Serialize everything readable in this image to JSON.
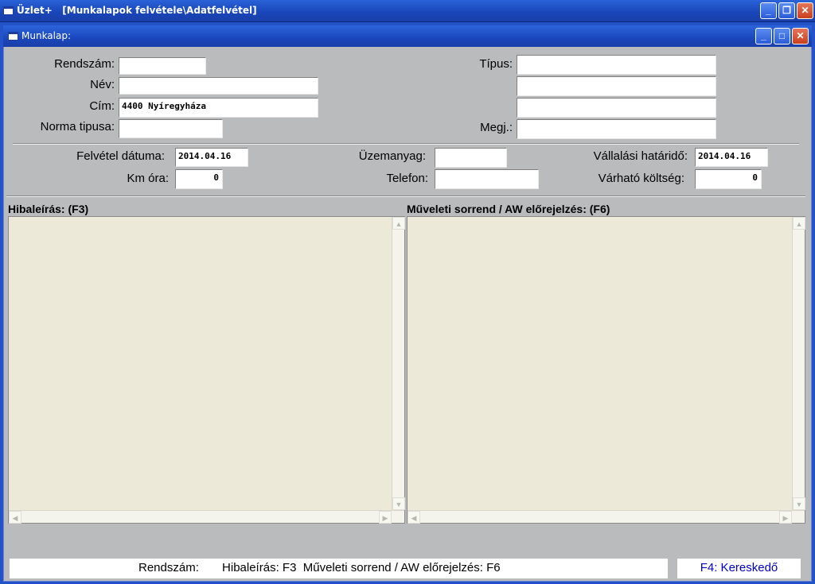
{
  "window": {
    "title": "Üzlet+   [Munkalapok felvétele\\Adatfelvétel]"
  },
  "child_window": {
    "title": "Munkalap:"
  },
  "title_buttons": {
    "minimize": "_",
    "restore": "❐",
    "maximize": "□",
    "close": "✕"
  },
  "form": {
    "rendszam": {
      "label": "Rendszám:",
      "value": ""
    },
    "nev": {
      "label": "Név:",
      "value": ""
    },
    "cim": {
      "label": "Cím:",
      "value": "4400 Nyíregyháza"
    },
    "norma": {
      "label": "Norma tipusa:",
      "value": ""
    },
    "tipus": {
      "label": "Típus:",
      "value": ""
    },
    "tipus2": {
      "value": ""
    },
    "tipus3": {
      "value": ""
    },
    "megj": {
      "label": "Megj.:",
      "value": ""
    },
    "felvetel": {
      "label": "Felvétel dátuma:",
      "value": "2014.04.16"
    },
    "km": {
      "label": "Km óra:",
      "value": "0"
    },
    "uzemanyag": {
      "label": "Üzemanyag:",
      "value": ""
    },
    "telefon": {
      "label": "Telefon:",
      "value": ""
    },
    "vallalasi": {
      "label": "Vállalási határidő:",
      "value": "2014.04.16"
    },
    "varhato": {
      "label": "Várható költség:",
      "value": "0"
    }
  },
  "sections": {
    "hibaleiras": "Hibaleírás:  (F3)",
    "muveleti": "Műveleti sorrend / AW előrejelzés:  (F6)"
  },
  "scroll": {
    "up": "▲",
    "down": "▼",
    "left": "◀",
    "right": "▶"
  },
  "status": {
    "text": "Rendszám:       Hibaleírás: F3  Műveleti sorrend / AW előrejelzés: F6",
    "dealer": "F4: Kereskedő"
  },
  "colors": {
    "dealer_text": "#0000cc",
    "memo_bg": "#ece9d8",
    "form_bg": "#b9bbbd"
  }
}
